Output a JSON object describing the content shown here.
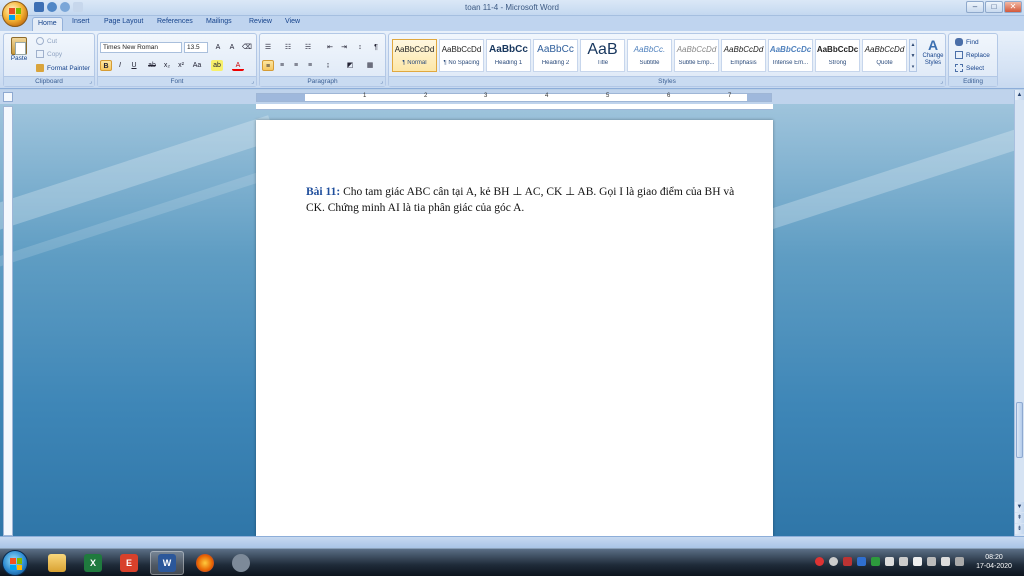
{
  "window": {
    "title": "toan 11-4 - Microsoft Word"
  },
  "tabs": [
    "Home",
    "Insert",
    "Page Layout",
    "References",
    "Mailings",
    "Review",
    "View"
  ],
  "clipboard": {
    "paste": "Paste",
    "cut": "Cut",
    "copy": "Copy",
    "format_painter": "Format Painter",
    "label": "Clipboard"
  },
  "font": {
    "name": "Times New Roman",
    "size": "13.5",
    "label": "Font"
  },
  "paragraph": {
    "label": "Paragraph"
  },
  "styles": {
    "label": "Styles",
    "items": [
      {
        "sample": "AaBbCcDd",
        "name": "¶ Normal"
      },
      {
        "sample": "AaBbCcDd",
        "name": "¶ No Spacing"
      },
      {
        "sample": "AaBbCc",
        "name": "Heading 1"
      },
      {
        "sample": "AaBbCc",
        "name": "Heading 2"
      },
      {
        "sample": "AaB",
        "name": "Title"
      },
      {
        "sample": "AaBbCc.",
        "name": "Subtitle"
      },
      {
        "sample": "AaBbCcDd",
        "name": "Subtle Emp..."
      },
      {
        "sample": "AaBbCcDd",
        "name": "Emphasis"
      },
      {
        "sample": "AaBbCcDc",
        "name": "Intense Em..."
      },
      {
        "sample": "AaBbCcDc",
        "name": "Strong"
      },
      {
        "sample": "AaBbCcDd",
        "name": "Quote"
      }
    ],
    "change_styles": "Change Styles"
  },
  "editing": {
    "find": "Find",
    "replace": "Replace",
    "select": "Select",
    "label": "Editing"
  },
  "ruler": {
    "numbers": [
      "1",
      "2",
      "3",
      "4",
      "5",
      "6",
      "7"
    ]
  },
  "document": {
    "label": "Bài 11:",
    "p1": " Cho tam giác ABC cân tại A, kẻ BH ⊥ AC, CK ⊥ AB. Gọi I là giao điểm của BH và CK. Chứng minh AI là tia phân giác của góc A."
  },
  "taskbar": {
    "time": "08:20",
    "date": "17-04-2020"
  },
  "colors": {
    "accent": "#15428b",
    "doc_bg": "#3e86b7",
    "heading_blue": "#1f4e9c"
  }
}
